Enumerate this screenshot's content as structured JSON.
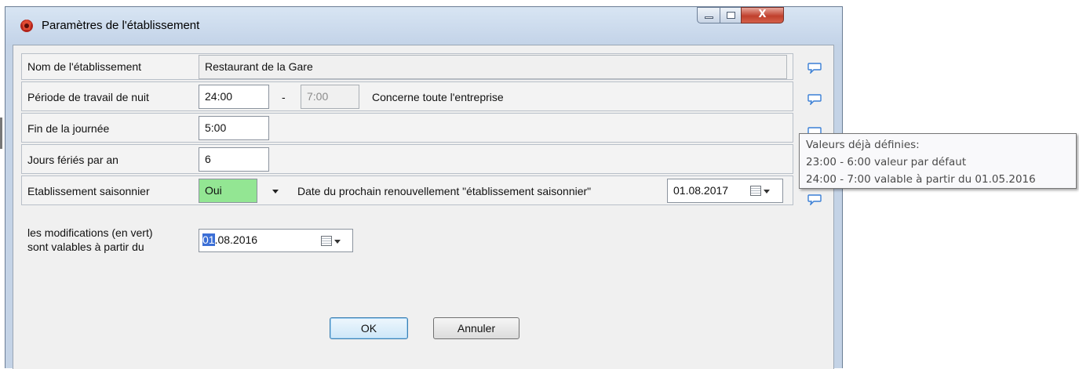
{
  "window": {
    "title": "Paramètres de l'établissement",
    "close_glyph": "X"
  },
  "form": {
    "nom": {
      "label": "Nom de l'établissement",
      "value": "Restaurant de la Gare"
    },
    "nuit": {
      "label": "Période de travail de nuit",
      "start": "24:00",
      "separator": "-",
      "end": "7:00",
      "note": "Concerne toute l'entreprise"
    },
    "fin": {
      "label": "Fin de la journée",
      "value": "5:00"
    },
    "feries": {
      "label": "Jours fériés par an",
      "value": "6"
    },
    "saison": {
      "label": "Etablissement saisonnier",
      "value": "Oui",
      "renew_label": "Date du prochain renouvellement \"établissement saisonnier\"",
      "renew_date": "01.08.2017"
    },
    "validity": {
      "label_line1": "les modifications (en vert)",
      "label_line2": "sont valables à partir du",
      "date_selected": "01",
      "date_rest": ".08.2016"
    }
  },
  "buttons": {
    "ok": "OK",
    "cancel": "Annuler"
  },
  "tooltip": {
    "line1": "Valeurs déjà définies:",
    "line2": "23:00 - 6:00 valeur par défaut",
    "line3": "24:00 - 7:00 valable à partir du 01.05.2016"
  },
  "colors": {
    "changed_field": "#93e693",
    "selection": "#3c6fd6",
    "comment_icon": "#3a7fd5"
  },
  "icons": [
    "app-icon",
    "minimize-icon",
    "maximize-icon",
    "close-icon",
    "comment-icon",
    "dropdown-arrow-icon",
    "calendar-icon"
  ]
}
